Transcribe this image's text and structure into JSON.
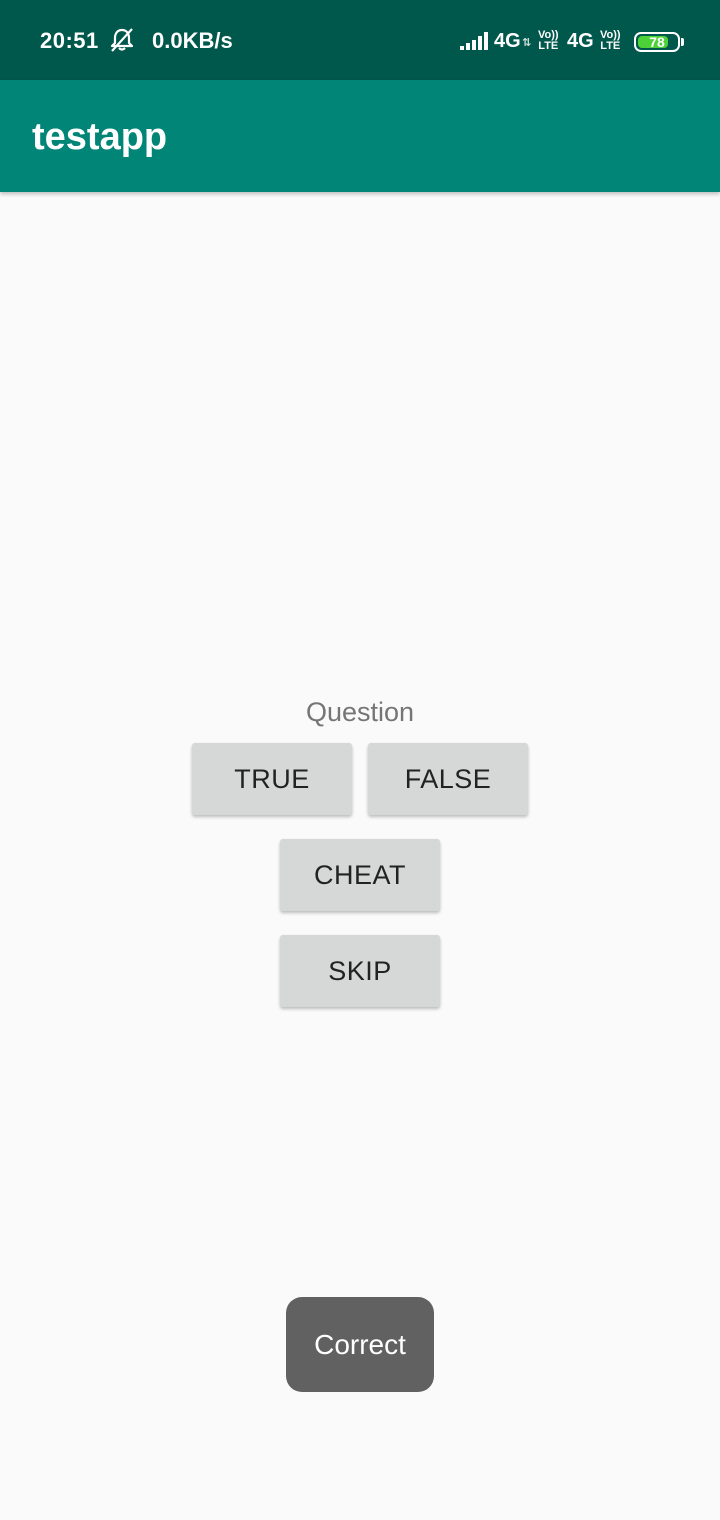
{
  "status_bar": {
    "time": "20:51",
    "network_speed": "0.0KB/s",
    "network_type_1": "4G",
    "network_type_2": "4G",
    "volte_label": "Vo)) LTE",
    "battery_level": "78",
    "battery_fraction": 0.78,
    "battery_color": "#4cd137",
    "icons": [
      "alarm-off-icon",
      "signal-icon"
    ]
  },
  "app_bar": {
    "title": "testapp",
    "background": "#008577"
  },
  "main": {
    "question": "Question",
    "buttons": {
      "true_label": "TRUE",
      "false_label": "FALSE",
      "cheat_label": "CHEAT",
      "skip_label": "SKIP"
    }
  },
  "toast": {
    "message": "Correct"
  }
}
